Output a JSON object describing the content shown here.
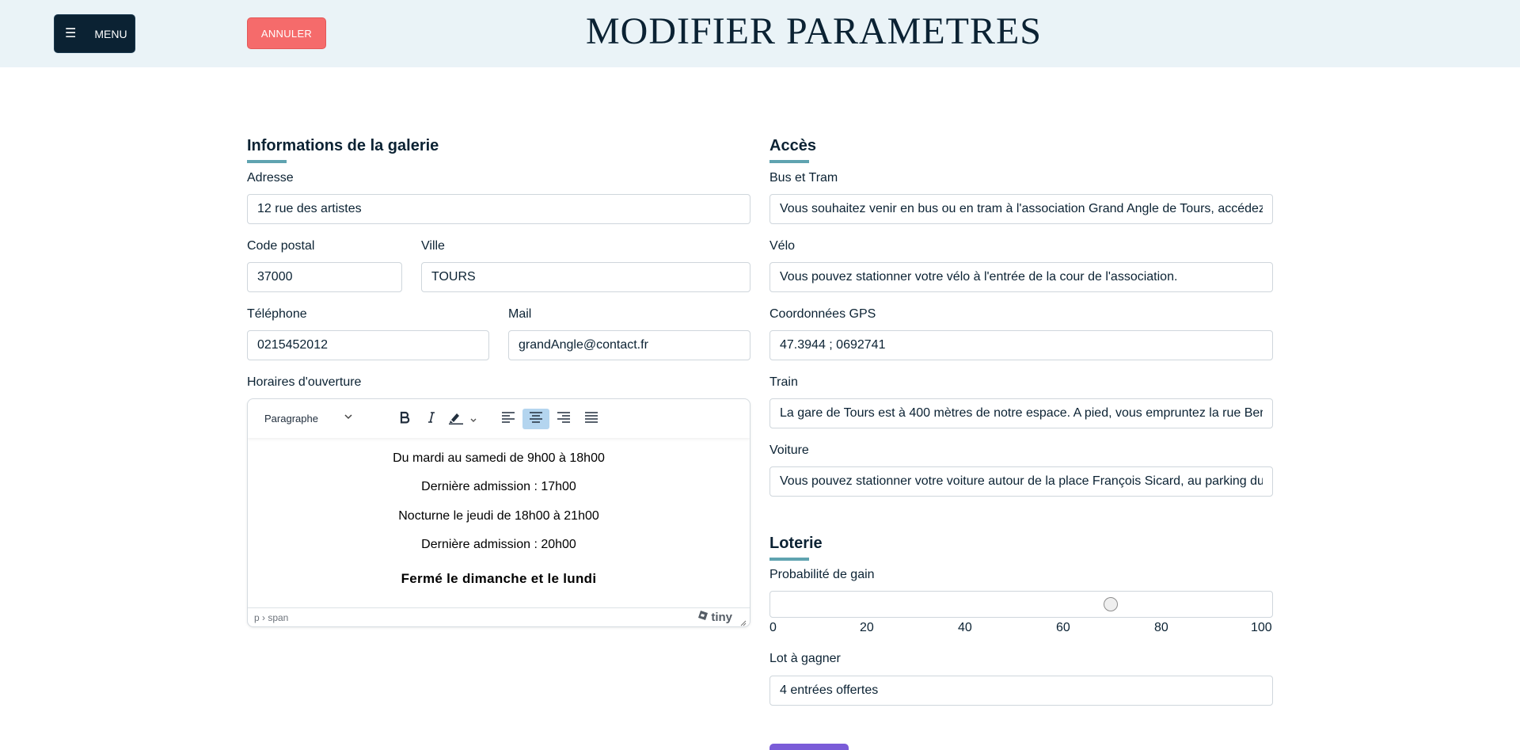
{
  "header": {
    "menu_icon": "☰",
    "menu_label": "MENU",
    "cancel_label": "ANNULER",
    "title": "MODIFIER PARAMETRES"
  },
  "gallery": {
    "title": "Informations de la galerie",
    "address_label": "Adresse",
    "address_value": "12 rue des artistes",
    "postal_label": "Code postal",
    "postal_value": "37000",
    "city_label": "Ville",
    "city_value": "TOURS",
    "phone_label": "Téléphone",
    "phone_value": "0215452012",
    "mail_label": "Mail",
    "mail_value": "grandAngle@contact.fr",
    "hours_label": "Horaires d'ouverture"
  },
  "editor": {
    "block_format": "Paragraphe",
    "toolbar_icons": [
      "bold-icon",
      "italic-icon",
      "highlight-icon",
      "align-left-icon",
      "align-center-icon",
      "align-right-icon",
      "align-justify-icon"
    ],
    "active_alignment": "center",
    "lines": [
      "Du mardi au samedi de 9h00 à 18h00",
      "Dernière admission : 17h00",
      "Nocturne le jeudi de 18h00 à 21h00",
      "Dernière admission : 20h00",
      "Fermé le dimanche et le lundi"
    ],
    "path": "p › span",
    "brand": "tiny"
  },
  "access": {
    "title": "Accès",
    "bus_label": "Bus et Tram",
    "bus_value": "Vous souhaitez venir en bus ou en tram à l'association Grand Angle de Tours, accédez",
    "bike_label": "Vélo",
    "bike_value": "Vous pouvez stationner votre vélo à l'entrée de la cour de l'association.",
    "gps_label": "Coordonnées GPS",
    "gps_value": "47.3944 ; 0692741",
    "train_label": "Train",
    "train_value": "La gare de Tours est à 400 mètres de notre espace. A pied, vous empruntez la rue Berr",
    "car_label": "Voiture",
    "car_value": "Vous pouvez stationner votre voiture autour de la place François Sicard, au parking du"
  },
  "lottery": {
    "title": "Loterie",
    "probability_label": "Probabilité de gain",
    "probability_value": 70,
    "ticks": [
      "0",
      "20",
      "40",
      "60",
      "80",
      "100"
    ],
    "prize_label": "Lot à gagner",
    "prize_value": "4 entrées offertes"
  },
  "colors": {
    "header_bg": "#eaf3f7",
    "navy": "#0b2233",
    "cancel": "#f56b6b",
    "accent_underline": "#5fa3b0",
    "submit": "#7a5cd8"
  }
}
